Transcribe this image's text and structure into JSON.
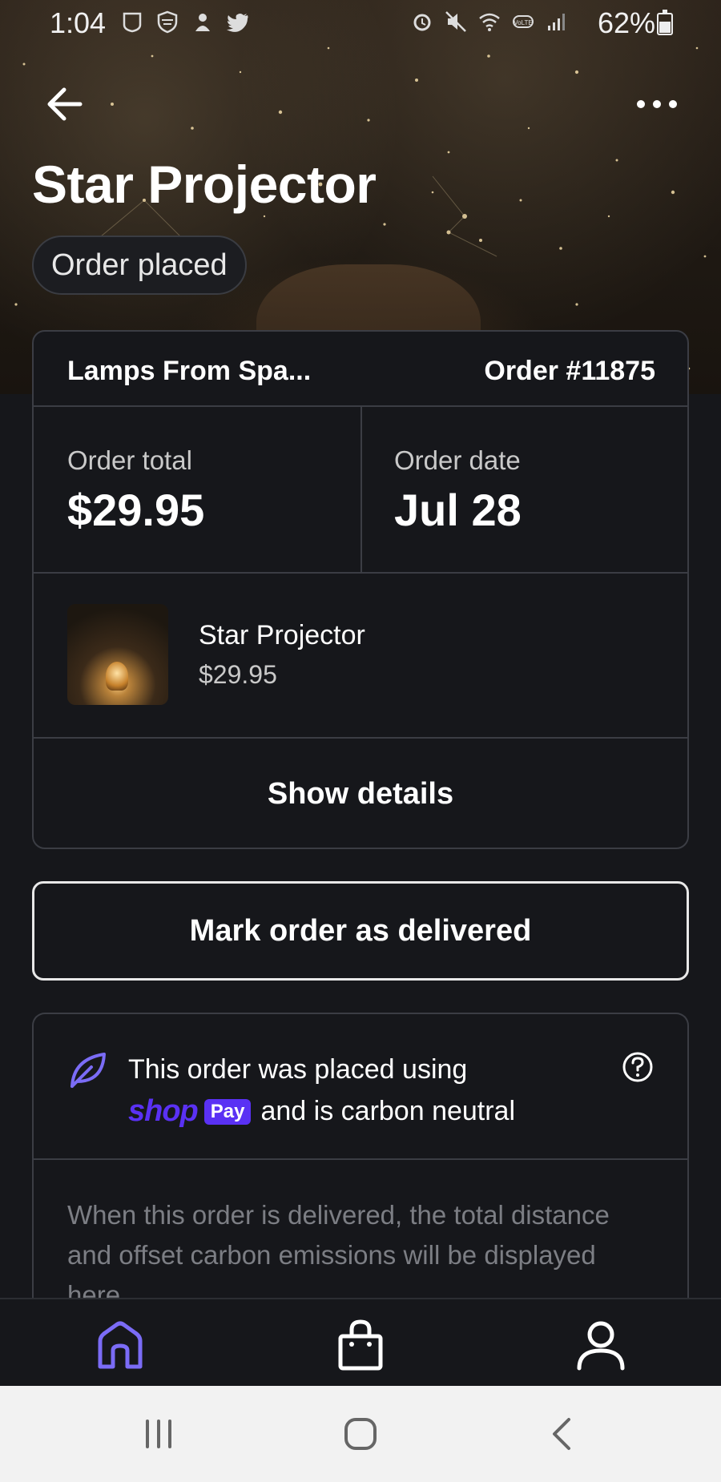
{
  "status_bar": {
    "time": "1:04",
    "battery": "62%",
    "left_icons": [
      "nhl-icon",
      "shield-icon",
      "emoji-icon",
      "twitter-icon"
    ],
    "right_icons": [
      "alarm-icon",
      "mute-icon",
      "wifi-icon",
      "volte-icon",
      "signal-icon"
    ]
  },
  "header": {
    "title": "Star Projector",
    "status": "Order placed"
  },
  "order": {
    "store": "Lamps From Spa...",
    "number": "Order #11875",
    "total_label": "Order total",
    "total_value": "$29.95",
    "date_label": "Order date",
    "date_value": "Jul 28",
    "item_name": "Star Projector",
    "item_price": "$29.95",
    "show_details": "Show details"
  },
  "actions": {
    "mark_delivered": "Mark order as delivered"
  },
  "carbon": {
    "line1": "This order was placed using",
    "shop_logo": "shop",
    "pay_badge": "Pay",
    "line2_suffix": "and is carbon neutral",
    "note": "When this order is delivered, the total distance and offset carbon emissions will be displayed here."
  },
  "tabs": [
    "home-icon",
    "shop-bag-icon",
    "profile-icon"
  ],
  "colors": {
    "accent": "#7b6cf6",
    "shop_purple": "#5a31f4",
    "background": "#16171b"
  }
}
